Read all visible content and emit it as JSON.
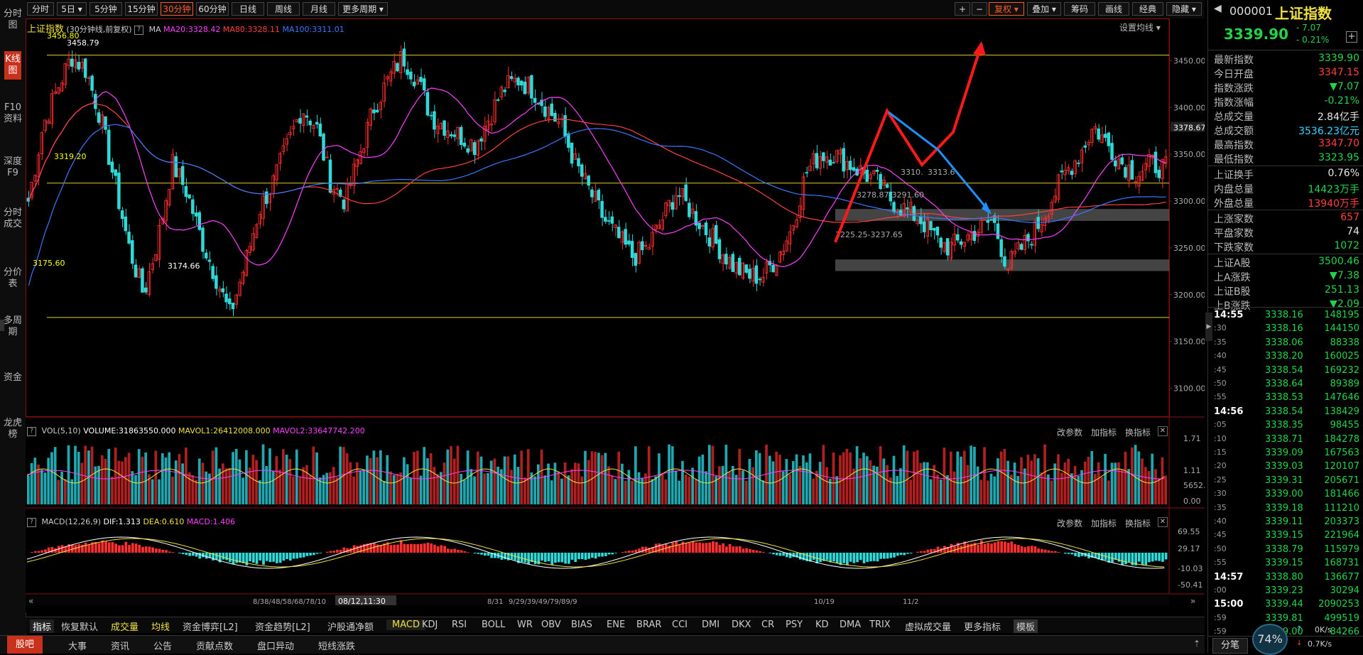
{
  "left_tabs": [
    "分时图",
    "K线图",
    "F10资料",
    "深度F9",
    "分时成交",
    "分价表",
    "多周期",
    "资金",
    "龙虎榜"
  ],
  "toolbar": {
    "periods": [
      "分时",
      "5日",
      "5分钟",
      "15分钟",
      "30分钟",
      "60分钟",
      "日线",
      "周线",
      "月线",
      "更多周期"
    ],
    "active_period": "30分钟",
    "right_buttons": [
      "+",
      "−",
      "复权",
      "叠加",
      "筹码",
      "画线",
      "经典",
      "隐藏"
    ]
  },
  "chart": {
    "title": "上证指数",
    "subtitle": "(30分钟线,前复权)",
    "ma_label": "MA",
    "ma20": "MA20:3328.42",
    "ma80": "MA80:3328.11",
    "ma100": "MA100:3311.01",
    "settings": "设置均线",
    "y_ticks": [
      "3450.00",
      "3400.00",
      "3378.67",
      "3350.00",
      "3300.00",
      "3250.00",
      "3200.00",
      "3150.00",
      "3100.00"
    ],
    "annotations": [
      "3458.79",
      "3456.80",
      "3319.20",
      "3175.60",
      "3174.66",
      "3278.87-3291.60",
      "3225.25-3237.65",
      "3310.",
      "3313.6"
    ],
    "price_series": [
      3300,
      3380,
      3420,
      3455,
      3440,
      3390,
      3320,
      3250,
      3200,
      3260,
      3340,
      3310,
      3260,
      3220,
      3178,
      3230,
      3290,
      3320,
      3360,
      3400,
      3380,
      3320,
      3300,
      3350,
      3400,
      3430,
      3455,
      3430,
      3390,
      3380,
      3370,
      3360,
      3390,
      3420,
      3430,
      3420,
      3400,
      3380,
      3340,
      3310,
      3280,
      3260,
      3240,
      3250,
      3280,
      3310,
      3290,
      3270,
      3250,
      3230,
      3220,
      3220,
      3240,
      3270,
      3330,
      3350,
      3350,
      3340,
      3330,
      3320,
      3300,
      3290,
      3280,
      3260,
      3250,
      3260,
      3270,
      3280,
      3230,
      3250,
      3270,
      3300,
      3330,
      3350,
      3380,
      3360,
      3340,
      3330,
      3340,
      3335
    ]
  },
  "volume": {
    "label": "VOL(5,10)",
    "volume": "VOLUME:31863550.000",
    "mavol1": "MAVOL1:26412008.000",
    "mavol2": "MAVOL2:33647742.200",
    "y_ticks": [
      "1.71",
      "1.11",
      "5652.00",
      "0.00"
    ],
    "buttons": [
      "改参数",
      "加指标",
      "换指标"
    ]
  },
  "macd": {
    "label": "MACD(12,26,9)",
    "dif": "DIF:1.313",
    "dea": "DEA:0.610",
    "macd": "MACD:1.406",
    "y_ticks": [
      "69.55",
      "29.17",
      "-10.03",
      "-50.41"
    ],
    "buttons": [
      "改参数",
      "加指标",
      "换指标"
    ]
  },
  "x_axis": {
    "labels": [
      "8/3",
      "8/4",
      "8/5",
      "8/6",
      "8/7",
      "8/10",
      "08/12,11:30",
      "8/31",
      "9/29/39/49/79/89/9",
      "10/19",
      "11/2"
    ]
  },
  "indicator_tabs": [
    "指标",
    "恢复默认",
    "成交量",
    "均线",
    "资金博弈[L2]",
    "资金趋势[L2]",
    "沪股通净额",
    "MACD",
    "KDJ",
    "RSI",
    "BOLL",
    "WR",
    "OBV",
    "BIAS",
    "ENE",
    "BRAR",
    "CCI",
    "DMI",
    "DKX",
    "CR",
    "PSY",
    "KD",
    "DMA",
    "TRIX",
    "虚拟成交量",
    "更多指标",
    "模板"
  ],
  "bottom_tabs": [
    "股吧",
    "大事",
    "资讯",
    "公告",
    "贡献点数",
    "盘口异动",
    "短线涨跌"
  ],
  "quote": {
    "code": "000001",
    "name": "上证指数",
    "price": "3339.90",
    "change": "- 7.07",
    "change_pct": "- 0.21%",
    "rows": [
      {
        "label": "最新指数",
        "value": "3339.90",
        "color": "grn"
      },
      {
        "label": "今日开盘",
        "value": "3347.15",
        "color": "red"
      },
      {
        "label": "指数涨跌",
        "value": "▼7.07",
        "color": "grn"
      },
      {
        "label": "指数涨幅",
        "value": "-0.21%",
        "color": "grn"
      },
      {
        "label": "总成交量",
        "value": "2.84亿手",
        "color": "wht"
      },
      {
        "label": "总成交额",
        "value": "3536.23亿元",
        "color": "cyan"
      },
      {
        "label": "最高指数",
        "value": "3347.70",
        "color": "red"
      },
      {
        "label": "最低指数",
        "value": "3323.95",
        "color": "grn"
      },
      {
        "label": "上证换手",
        "value": "0.76%",
        "color": "wht"
      },
      {
        "label": "内盘总量",
        "value": "14423万手",
        "color": "grn"
      },
      {
        "label": "外盘总量",
        "value": "13940万手",
        "color": "red"
      },
      {
        "label": "上涨家数",
        "value": "657",
        "color": "red"
      },
      {
        "label": "平盘家数",
        "value": "74",
        "color": "wht"
      },
      {
        "label": "下跌家数",
        "value": "1072",
        "color": "grn"
      },
      {
        "label": "上证A股",
        "value": "3500.46",
        "color": "grn"
      },
      {
        "label": "上A涨跌",
        "value": "▼7.38",
        "color": "grn"
      },
      {
        "label": "上证B股",
        "value": "251.13",
        "color": "grn"
      },
      {
        "label": "上B涨跌",
        "value": "▼2.09",
        "color": "grn"
      }
    ],
    "ticks": [
      {
        "t": "14:55",
        "p": "3338.16",
        "q": "148195",
        "bold": true
      },
      {
        "t": ":30",
        "p": "3338.16",
        "q": "144150"
      },
      {
        "t": ":35",
        "p": "3338.06",
        "q": "88338"
      },
      {
        "t": ":40",
        "p": "3338.20",
        "q": "160025"
      },
      {
        "t": ":45",
        "p": "3338.54",
        "q": "169232"
      },
      {
        "t": ":50",
        "p": "3338.64",
        "q": "89389"
      },
      {
        "t": ":55",
        "p": "3338.53",
        "q": "147646"
      },
      {
        "t": "14:56",
        "p": "3338.54",
        "q": "138429",
        "bold": true
      },
      {
        "t": ":05",
        "p": "3338.35",
        "q": "98455"
      },
      {
        "t": ":10",
        "p": "3338.71",
        "q": "184278"
      },
      {
        "t": ":15",
        "p": "3339.09",
        "q": "167563"
      },
      {
        "t": ":20",
        "p": "3339.03",
        "q": "120107"
      },
      {
        "t": ":25",
        "p": "3339.31",
        "q": "205671"
      },
      {
        "t": ":30",
        "p": "3339.00",
        "q": "181466"
      },
      {
        "t": ":35",
        "p": "3339.18",
        "q": "111210"
      },
      {
        "t": ":40",
        "p": "3339.11",
        "q": "203373"
      },
      {
        "t": ":45",
        "p": "3339.15",
        "q": "221964"
      },
      {
        "t": ":50",
        "p": "3338.79",
        "q": "115979"
      },
      {
        "t": ":55",
        "p": "3339.15",
        "q": "168731"
      },
      {
        "t": "14:57",
        "p": "3338.80",
        "q": "136677",
        "bold": true
      },
      {
        "t": ":00",
        "p": "3339.23",
        "q": "30294"
      },
      {
        "t": "15:00",
        "p": "3339.44",
        "q": "2090253",
        "bold": true
      },
      {
        "t": ":59",
        "p": "3339.81",
        "q": "499519"
      },
      {
        "t": ":59",
        "p": "3339.00",
        "q": "84266"
      }
    ],
    "footer": {
      "tab": "分笔",
      "cpu": "74%",
      "net_up": "0K/s",
      "net_down": "0.7K/s"
    }
  }
}
